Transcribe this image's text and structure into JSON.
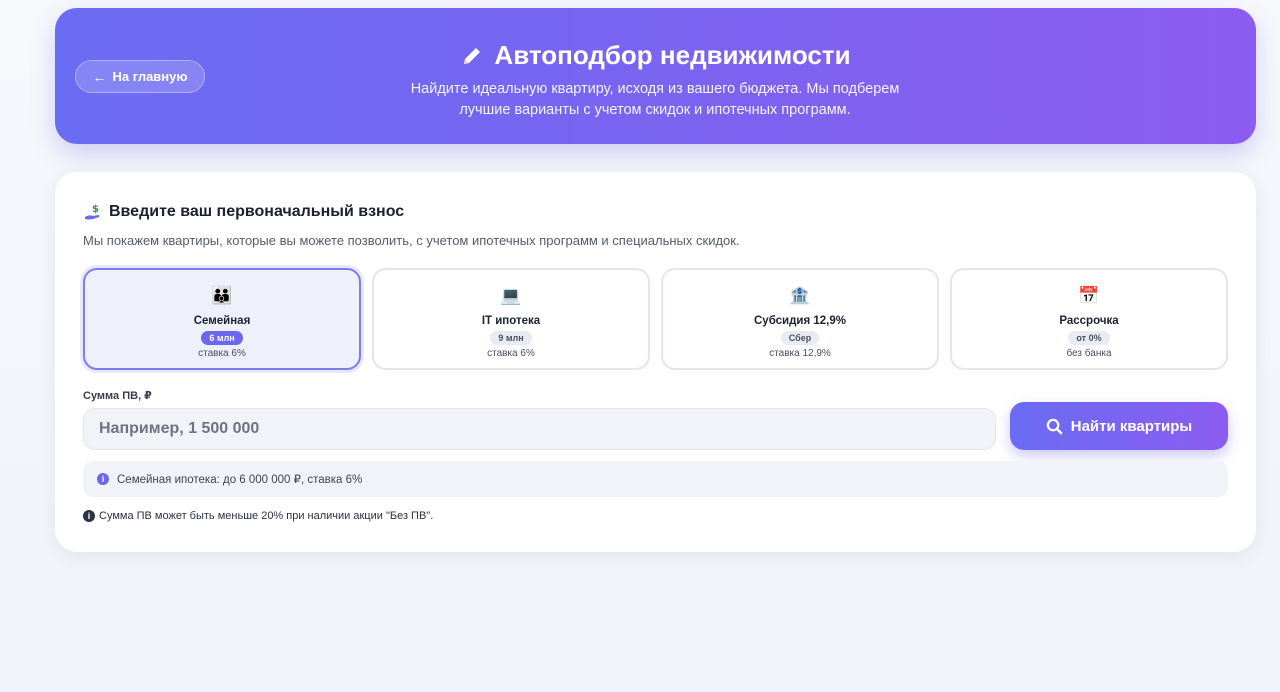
{
  "header": {
    "back_label": "На главную",
    "title": "Автоподбор недвижимости",
    "subtitle": "Найдите идеальную квартиру, исходя из вашего бюджета. Мы подберем лучшие варианты с учетом скидок и ипотечных программ."
  },
  "form": {
    "title": "Введите ваш первоначальный взнос",
    "description": "Мы покажем квартиры, которые вы можете позволить, с учетом ипотечных программ и специальных скидок.",
    "programs": [
      {
        "icon": "family-icon",
        "glyph": "👪",
        "name": "Семейная",
        "badge": "6 млн",
        "rate": "ставка 6%",
        "selected": true
      },
      {
        "icon": "laptop-icon",
        "glyph": "💻",
        "name": "IT ипотека",
        "badge": "9 млн",
        "rate": "ставка 6%",
        "selected": false
      },
      {
        "icon": "bank-icon",
        "glyph": "🏦",
        "name": "Субсидия 12,9%",
        "badge": "Сбер",
        "rate": "ставка 12,9%",
        "selected": false
      },
      {
        "icon": "calendar-icon",
        "glyph": "📅",
        "name": "Рассрочка",
        "badge": "от 0%",
        "rate": "без банка",
        "selected": false
      }
    ],
    "amount_label": "Сумма ПВ, ₽",
    "amount_placeholder": "Например, 1 500 000",
    "amount_value": "",
    "submit_label": "Найти квартиры",
    "info_text": "Семейная ипотека: до 6 000 000 ₽, ставка 6%",
    "note_text": "Сумма ПВ может быть меньше 20% при наличии акции \"Без ПВ\"."
  },
  "colors": {
    "accent": "#6b67ee",
    "gradient_start": "#6a6cf3",
    "gradient_end": "#8c5cf0"
  }
}
